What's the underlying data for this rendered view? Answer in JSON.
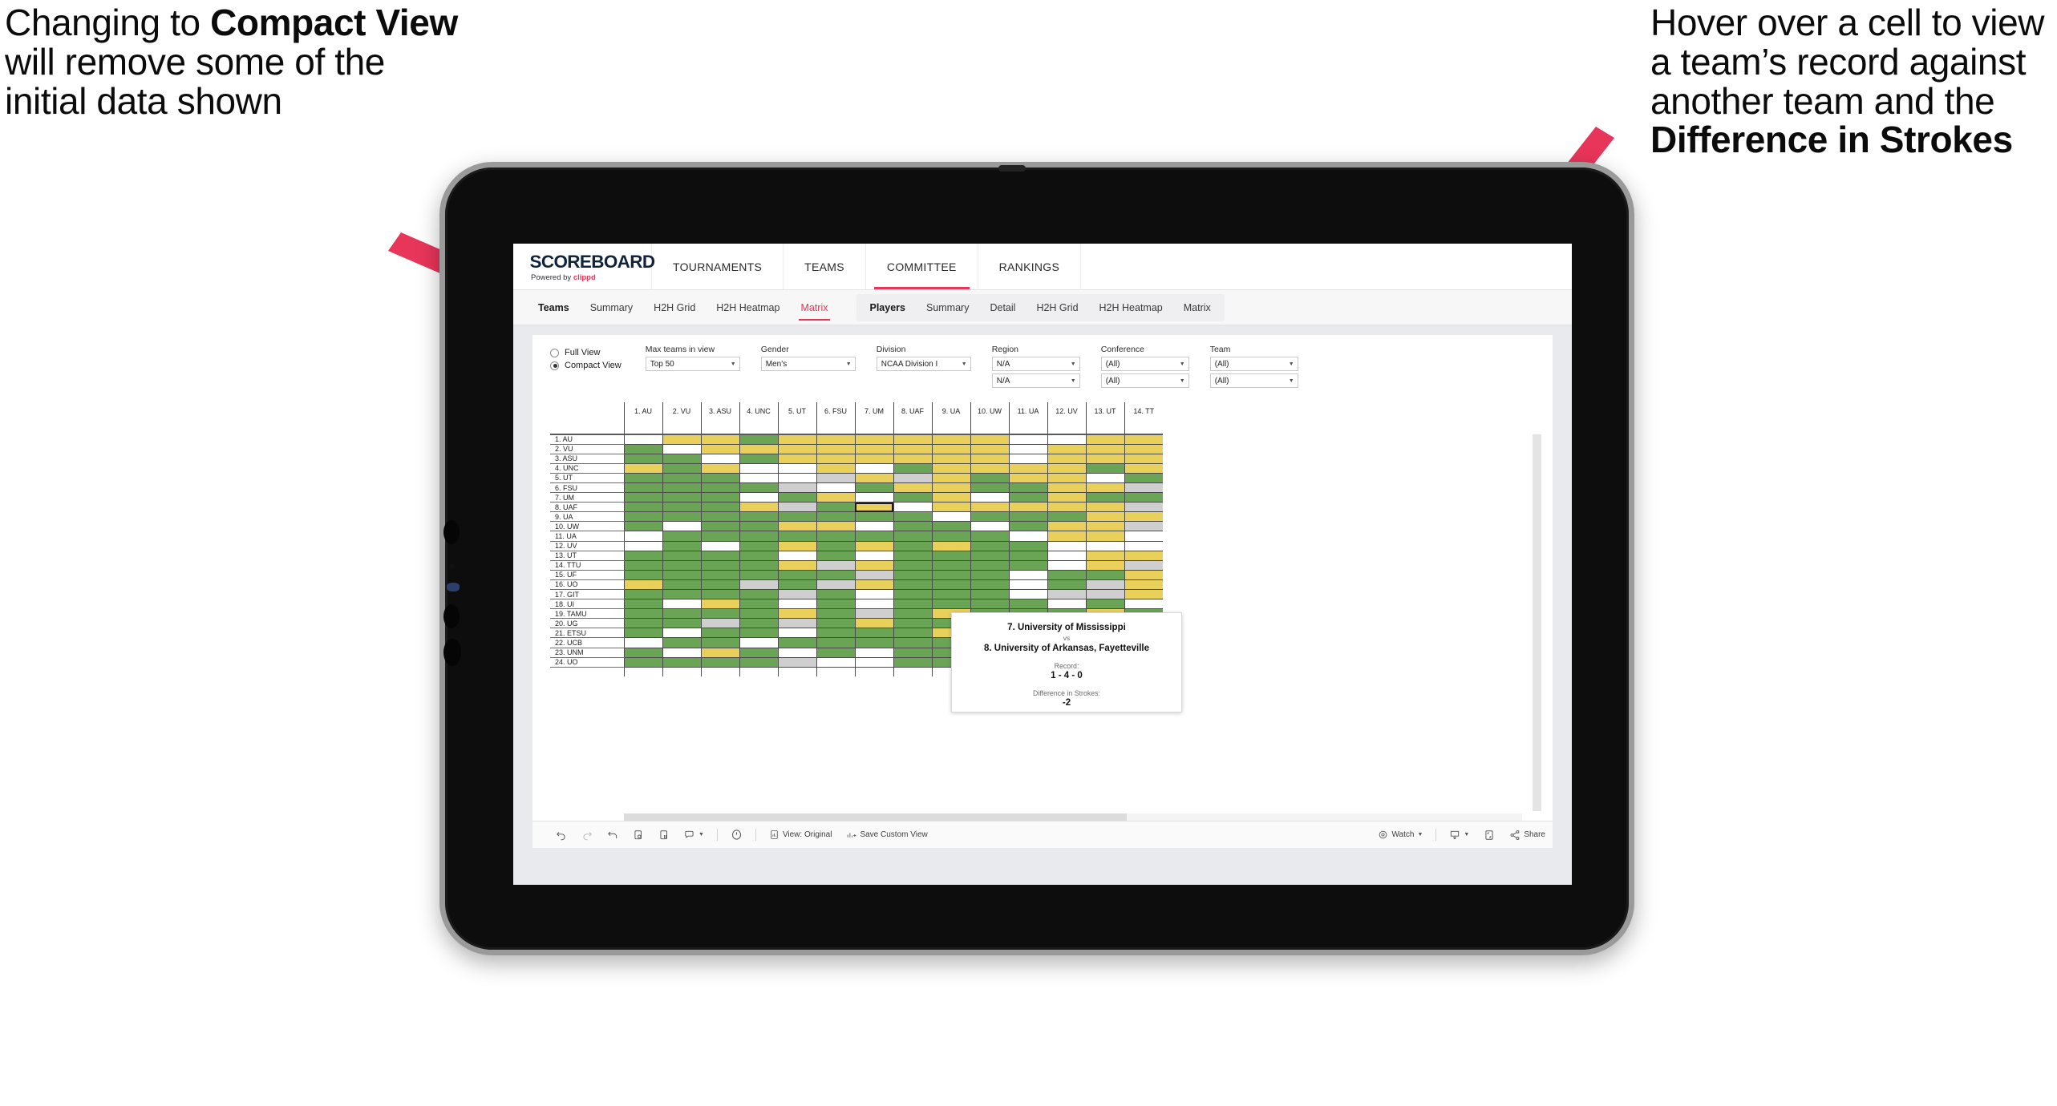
{
  "annotations": {
    "left": {
      "pre": "Changing to ",
      "bold": "Compact View",
      "post": " will remove some of the initial data shown"
    },
    "right": {
      "pre": "Hover over a cell to view a team’s record against another team and the ",
      "bold": "Difference in Strokes",
      "post": ""
    }
  },
  "brand": {
    "title": "SCOREBOARD",
    "powered_prefix": "Powered by ",
    "powered_name": "clippd"
  },
  "topnav": [
    {
      "label": "TOURNAMENTS",
      "active": false
    },
    {
      "label": "TEAMS",
      "active": false
    },
    {
      "label": "COMMITTEE",
      "active": true
    },
    {
      "label": "RANKINGS",
      "active": false
    }
  ],
  "subnav": {
    "teams_group": {
      "title": "Teams",
      "items": [
        {
          "label": "Summary",
          "active": false
        },
        {
          "label": "H2H Grid",
          "active": false
        },
        {
          "label": "H2H Heatmap",
          "active": false
        },
        {
          "label": "Matrix",
          "active": true
        }
      ]
    },
    "players_group": {
      "title": "Players",
      "items": [
        {
          "label": "Summary",
          "active": false
        },
        {
          "label": "Detail",
          "active": false
        },
        {
          "label": "H2H Grid",
          "active": false
        },
        {
          "label": "H2H Heatmap",
          "active": false
        },
        {
          "label": "Matrix",
          "active": false
        }
      ]
    }
  },
  "filters": {
    "view_mode": {
      "options": [
        "Full View",
        "Compact View"
      ],
      "selected": "Compact View"
    },
    "max_teams": {
      "label": "Max teams in view",
      "value": "Top 50"
    },
    "gender": {
      "label": "Gender",
      "value": "Men’s"
    },
    "division": {
      "label": "Division",
      "value": "NCAA Division I"
    },
    "region": {
      "label": "Region",
      "value1": "N/A",
      "value2": "N/A"
    },
    "conference": {
      "label": "Conference",
      "value1": "(All)",
      "value2": "(All)"
    },
    "team": {
      "label": "Team",
      "value1": "(All)",
      "value2": "(All)"
    }
  },
  "matrix": {
    "columns": [
      "1. AU",
      "2. VU",
      "3. ASU",
      "4. UNC",
      "5. UT",
      "6. FSU",
      "7. UM",
      "8. UAF",
      "9. UA",
      "10. UW",
      "11. UA",
      "12. UV",
      "13. UT",
      "14. TT"
    ],
    "rows": [
      "1. AU",
      "2. VU",
      "3. ASU",
      "4. UNC",
      "5. UT",
      "6. FSU",
      "7. UM",
      "8. UAF",
      "9. UA",
      "10. UW",
      "11. UA",
      "12. UV",
      "13. UT",
      "14. TTU",
      "15. UF",
      "16. UO",
      "17. GIT",
      "18. UI",
      "19. TAMU",
      "20. UG",
      "21. ETSU",
      "22. UCB",
      "23. UNM",
      "24. UO"
    ],
    "legend_colors": {
      "win": "#6aa455",
      "loss": "#e9d05a",
      "tie": "#cfcfcf",
      "none": "#ffffff"
    },
    "cells": [
      [
        "w",
        "y",
        "y",
        "g",
        "y",
        "y",
        "y",
        "y",
        "y",
        "y",
        "w",
        "w",
        "y",
        "y"
      ],
      [
        "g",
        "w",
        "y",
        "y",
        "y",
        "y",
        "y",
        "y",
        "y",
        "y",
        "w",
        "y",
        "y",
        "y"
      ],
      [
        "g",
        "g",
        "w",
        "g",
        "y",
        "y",
        "y",
        "y",
        "y",
        "y",
        "w",
        "y",
        "y",
        "y"
      ],
      [
        "y",
        "g",
        "y",
        "w",
        "w",
        "y",
        "w",
        "g",
        "y",
        "y",
        "y",
        "y",
        "g",
        "y"
      ],
      [
        "g",
        "g",
        "g",
        "w",
        "w",
        "s",
        "y",
        "s",
        "y",
        "g",
        "y",
        "y",
        "w",
        "g"
      ],
      [
        "g",
        "g",
        "g",
        "g",
        "s",
        "w",
        "g",
        "y",
        "y",
        "g",
        "g",
        "y",
        "y",
        "s"
      ],
      [
        "g",
        "g",
        "g",
        "w",
        "g",
        "y",
        "w",
        "g",
        "y",
        "w",
        "g",
        "y",
        "g",
        "g"
      ],
      [
        "g",
        "g",
        "g",
        "y",
        "s",
        "g",
        "hl",
        "w",
        "y",
        "y",
        "y",
        "y",
        "y",
        "s"
      ],
      [
        "g",
        "g",
        "g",
        "g",
        "g",
        "g",
        "g",
        "g",
        "w",
        "g",
        "g",
        "g",
        "y",
        "y"
      ],
      [
        "g",
        "w",
        "g",
        "g",
        "y",
        "y",
        "w",
        "g",
        "g",
        "w",
        "g",
        "y",
        "y",
        "s"
      ],
      [
        "w",
        "g",
        "g",
        "g",
        "g",
        "g",
        "g",
        "g",
        "g",
        "g",
        "w",
        "y",
        "y",
        "w"
      ],
      [
        "w",
        "g",
        "w",
        "g",
        "y",
        "g",
        "y",
        "g",
        "y",
        "g",
        "g",
        "w",
        "w",
        "w"
      ],
      [
        "g",
        "g",
        "g",
        "g",
        "w",
        "g",
        "w",
        "g",
        "g",
        "g",
        "g",
        "w",
        "y",
        "y"
      ],
      [
        "g",
        "g",
        "g",
        "g",
        "y",
        "s",
        "y",
        "g",
        "g",
        "g",
        "g",
        "w",
        "y",
        "s"
      ],
      [
        "g",
        "g",
        "g",
        "g",
        "g",
        "g",
        "s",
        "g",
        "g",
        "g",
        "w",
        "g",
        "g",
        "y"
      ],
      [
        "y",
        "g",
        "g",
        "s",
        "g",
        "s",
        "y",
        "g",
        "g",
        "g",
        "w",
        "g",
        "s",
        "y"
      ],
      [
        "g",
        "g",
        "g",
        "g",
        "s",
        "g",
        "w",
        "g",
        "g",
        "g",
        "w",
        "s",
        "s",
        "y"
      ],
      [
        "g",
        "w",
        "y",
        "g",
        "w",
        "g",
        "w",
        "g",
        "g",
        "g",
        "g",
        "w",
        "g",
        "w"
      ],
      [
        "g",
        "g",
        "g",
        "g",
        "y",
        "g",
        "s",
        "g",
        "y",
        "g",
        "g",
        "g",
        "y",
        "g"
      ],
      [
        "g",
        "g",
        "s",
        "g",
        "s",
        "g",
        "y",
        "g",
        "g",
        "w",
        "w",
        "g",
        "s",
        "y"
      ],
      [
        "g",
        "w",
        "g",
        "g",
        "w",
        "g",
        "g",
        "g",
        "y",
        "w",
        "w",
        "g",
        "g",
        "y"
      ],
      [
        "w",
        "g",
        "g",
        "w",
        "g",
        "g",
        "g",
        "g",
        "g",
        "y",
        "w",
        "g",
        "y",
        "s"
      ],
      [
        "g",
        "w",
        "y",
        "g",
        "w",
        "g",
        "w",
        "g",
        "g",
        "g",
        "w",
        "g",
        "g",
        "g"
      ],
      [
        "g",
        "g",
        "g",
        "g",
        "s",
        "w",
        "w",
        "g",
        "g",
        "y",
        "y",
        "g",
        "y",
        "g"
      ]
    ]
  },
  "tooltip": {
    "team_a": "7. University of Mississippi",
    "vs": "vs",
    "team_b": "8. University of Arkansas, Fayetteville",
    "record_label": "Record:",
    "record_value": "1 - 4 - 0",
    "diff_label": "Difference in Strokes:",
    "diff_value": "-2"
  },
  "toolbar": {
    "undo": "undo-icon",
    "redo": "redo-icon",
    "revert": "revert-icon",
    "refresh": "refresh-data-icon",
    "pause": "pause-auto-update-icon",
    "view_original": "View: Original",
    "save_custom_view": "Save Custom View",
    "watch": "Watch",
    "share": "Share"
  },
  "accent_color": "#e8355a"
}
